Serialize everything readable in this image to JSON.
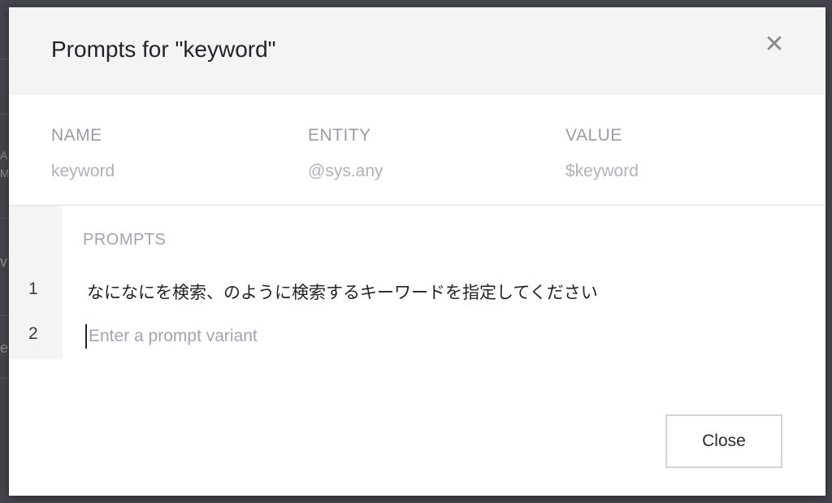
{
  "dialog": {
    "title": "Prompts for \"keyword\"",
    "close_icon": "close-icon"
  },
  "parameter": {
    "name_header": "NAME",
    "entity_header": "ENTITY",
    "value_header": "VALUE",
    "name": "keyword",
    "entity": "@sys.any",
    "value": "$keyword"
  },
  "prompts": {
    "label": "PROMPTS",
    "rows": [
      {
        "number": "1",
        "text": "なになにを検索、のように検索するキーワードを指定してください"
      },
      {
        "number": "2",
        "text": ""
      }
    ],
    "input_placeholder": "Enter a prompt variant"
  },
  "footer": {
    "close_label": "Close"
  },
  "background": {
    "fragments": [
      "A",
      "M",
      "v",
      "e"
    ]
  },
  "colors": {
    "header_bg": "#f4f4f4",
    "muted_text": "#9a9ba6",
    "overlay": "#3a3b42"
  }
}
